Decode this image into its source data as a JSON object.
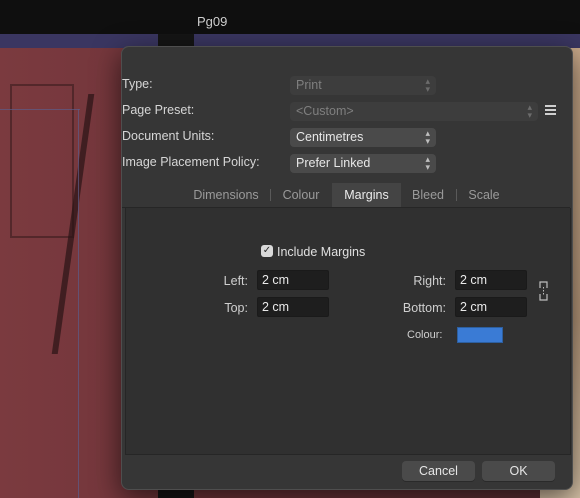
{
  "window": {
    "document_title": "Pg09"
  },
  "dialog": {
    "type": {
      "label": "Type:",
      "value": "Print"
    },
    "page_preset": {
      "label": "Page Preset:",
      "value": "<Custom>"
    },
    "document_units": {
      "label": "Document Units:",
      "value": "Centimetres"
    },
    "image_placement": {
      "label": "Image Placement Policy:",
      "value": "Prefer Linked"
    },
    "tabs": [
      {
        "label": "Dimensions"
      },
      {
        "label": "Colour"
      },
      {
        "label": "Margins"
      },
      {
        "label": "Bleed"
      },
      {
        "label": "Scale"
      }
    ],
    "active_tab": "Margins",
    "margins": {
      "include_label": "Include Margins",
      "include_checked": true,
      "left_label": "Left:",
      "left_value": "2 cm",
      "top_label": "Top:",
      "top_value": "2 cm",
      "right_label": "Right:",
      "right_value": "2 cm",
      "bottom_label": "Bottom:",
      "bottom_value": "2 cm",
      "colour_label": "Colour:",
      "colour_value": "#3a7bd5"
    },
    "buttons": {
      "cancel": "Cancel",
      "ok": "OK"
    }
  },
  "icons": {
    "chevron": "up-down-chevron-icon",
    "menu": "hamburger-menu-icon",
    "link": "link-margins-icon",
    "check": "✓"
  }
}
